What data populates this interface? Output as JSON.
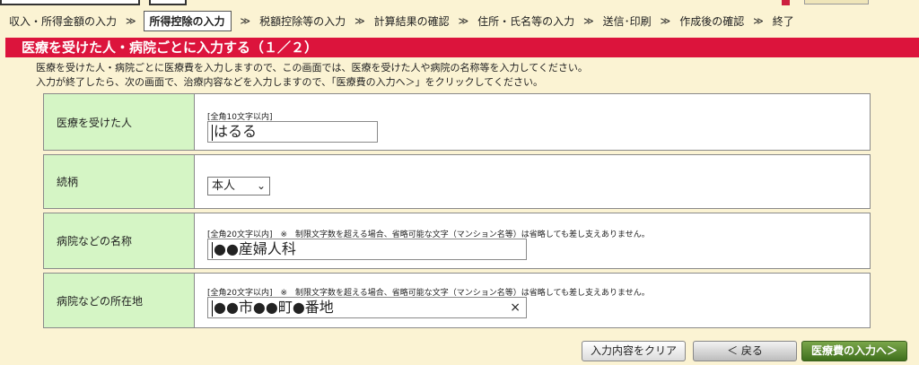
{
  "steps": [
    {
      "label": "収入・所得金額の入力"
    },
    {
      "label": "所得控除の入力",
      "active": true
    },
    {
      "label": "税額控除等の入力"
    },
    {
      "label": "計算結果の確認"
    },
    {
      "label": "住所・氏名等の入力"
    },
    {
      "label": "送信･印刷"
    },
    {
      "label": "作成後の確認"
    },
    {
      "label": "終了"
    }
  ],
  "separator": "≫",
  "page": {
    "title": "医療を受けた人・病院ごとに入力する（１／２）",
    "description_line1": "医療を受けた人・病院ごとに医療費を入力しますので、この画面では、医療を受けた人や病院の名称等を入力してください。",
    "description_line2": "入力が終了したら、次の画面で、治療内容などを入力しますので、「医療費の入力へ＞」をクリックしてください。"
  },
  "form": {
    "patient": {
      "label": "医療を受けた人",
      "hint": "[全角10文字以内]",
      "value": "はるる"
    },
    "relationship": {
      "label": "続柄",
      "selected": "本人"
    },
    "hospital_name": {
      "label": "病院などの名称",
      "hint": "[全角20文字以内]　※　制限文字数を超える場合、省略可能な文字（マンション名等）は省略しても差し支えありません。",
      "value": "●●産婦人科"
    },
    "hospital_address": {
      "label": "病院などの所在地",
      "hint": "[全角20文字以内]　※　制限文字数を超える場合、省略可能な文字（マンション名等）は省略しても差し支えありません。",
      "value": "●●市●●町●番地",
      "clear_icon": "×"
    }
  },
  "buttons": {
    "clear": "入力内容をクリア",
    "back": "＜ 戻る",
    "next": "医療費の入力へ＞"
  },
  "colors": {
    "background": "#fbf3d3",
    "title_bar": "#dc143c",
    "label_cell": "#d5f5c5",
    "next_button": "#4a7a24"
  }
}
